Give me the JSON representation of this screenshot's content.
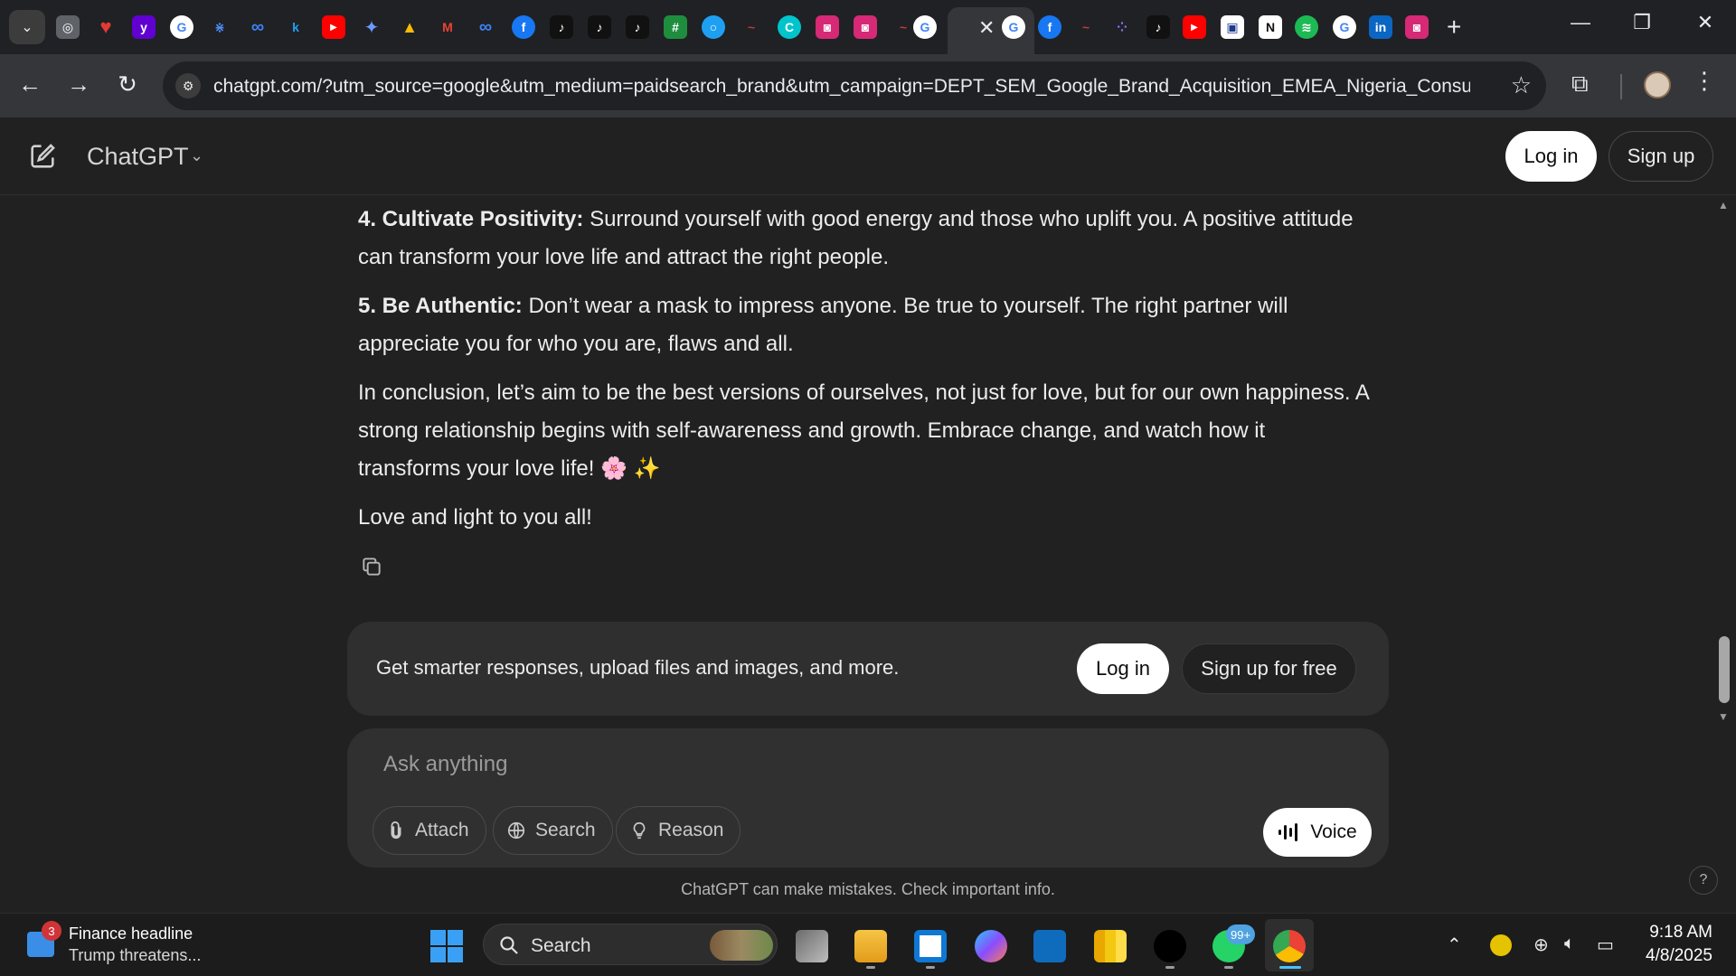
{
  "browser": {
    "url": "chatgpt.com/?utm_source=google&utm_medium=paidsearch_brand&utm_campaign=DEPT_SEM_Google_Brand_Acquisition_EMEA_Nigeria_Consumer...",
    "active_tab_close": "✕"
  },
  "header": {
    "title": "ChatGPT",
    "login_label": "Log in",
    "signup_label": "Sign up"
  },
  "conversation": {
    "items": [
      {
        "heading": "4. Cultivate Positivity:",
        "text": " Surround yourself with good energy and those who uplift you. A positive attitude can transform your love life and attract the right people."
      },
      {
        "heading": "5. Be Authentic:",
        "text": " Don’t wear a mask to impress anyone. Be true to yourself. The right partner will appreciate you for who you are, flaws and all."
      }
    ],
    "conclusion": "In conclusion, let’s aim to be the best versions of ourselves, not just for love, but for our own happiness. A strong relationship begins with self-awareness and growth. Embrace change, and watch how it transforms your love life! 🌸 ✨",
    "signoff": "Love and light to you all!"
  },
  "upsell": {
    "text": "Get smarter responses, upload files and images, and more.",
    "login_label": "Log in",
    "signup_label": "Sign up for free"
  },
  "composer": {
    "placeholder": "Ask anything",
    "attach_label": "Attach",
    "search_label": "Search",
    "reason_label": "Reason",
    "voice_label": "Voice"
  },
  "disclaimer": "ChatGPT can make mistakes. Check important info.",
  "help_label": "?",
  "taskbar": {
    "news_badge": "3",
    "news_title": "Finance headline",
    "news_subtitle": "Trump threatens...",
    "search_label": "Search",
    "whatsapp_badge": "99+",
    "time": "9:18 AM",
    "date": "4/8/2025"
  },
  "colors": {
    "background": "#212121",
    "composer": "#303030",
    "button_primary": "#ffffff",
    "windows_accent": "#3aa0f5"
  }
}
